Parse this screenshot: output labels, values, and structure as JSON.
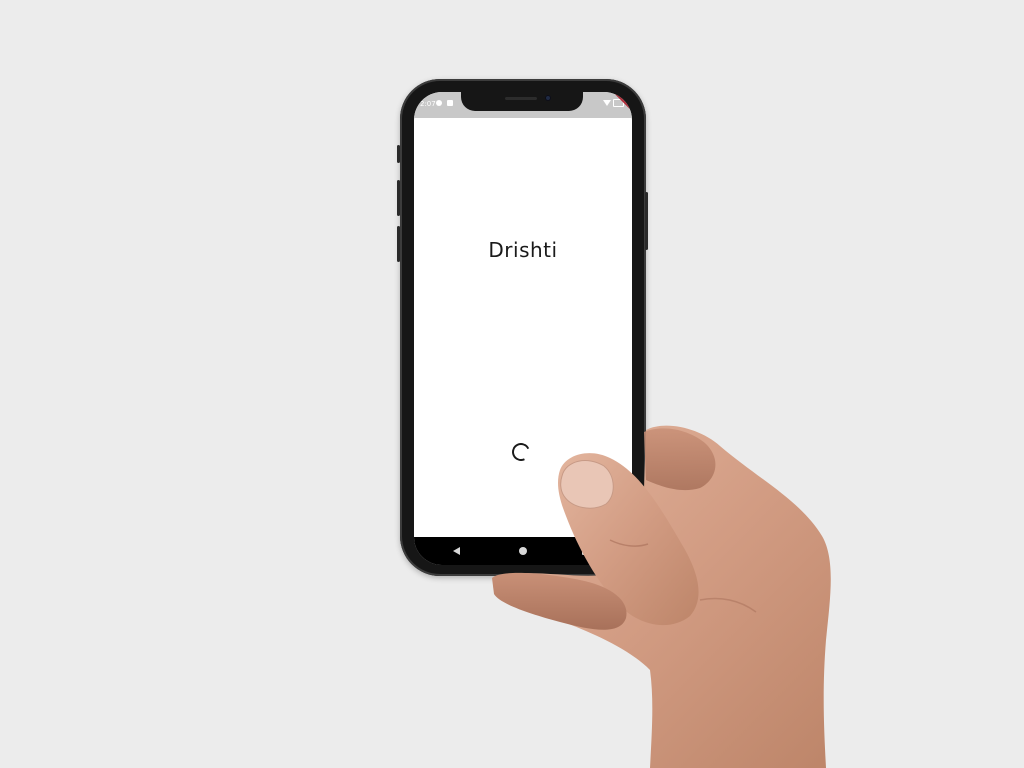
{
  "status_bar": {
    "time": "2:07",
    "icons": [
      "app-notification-icon",
      "sd-card-icon",
      "wifi-icon",
      "battery-icon"
    ],
    "background_color": "#c8c8c8"
  },
  "app": {
    "title": "Drishti",
    "state": "loading",
    "loading_indicator_icon": "circular-progress-icon"
  },
  "nav_bar": {
    "buttons": [
      "back-icon",
      "home-icon",
      "recents-icon"
    ],
    "background_color": "#000000"
  },
  "colors": {
    "page_background": "#ececec",
    "screen_background": "#ffffff",
    "text": "#1a1a1a",
    "debug_banner": "#b02a37"
  }
}
